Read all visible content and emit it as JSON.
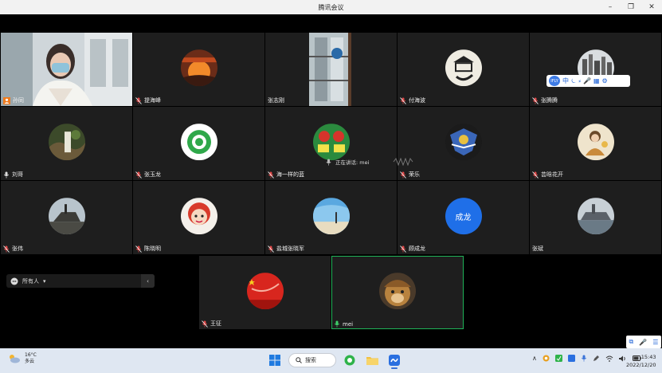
{
  "window": {
    "title": "腾讯会议",
    "minimize": "–",
    "maximize": "❐",
    "close": "✕"
  },
  "participants": [
    {
      "name": "孙同",
      "muted": false,
      "host": true
    },
    {
      "name": "提海峰",
      "muted": true
    },
    {
      "name": "张志刚",
      "muted": true
    },
    {
      "name": "付海波",
      "muted": true
    },
    {
      "name": "张腾腾",
      "muted": true
    },
    {
      "name": "刘哥",
      "muted": false
    },
    {
      "name": "张玉龙",
      "muted": true
    },
    {
      "name": "海一样的蓝",
      "muted": true
    },
    {
      "name": "荣乐",
      "muted": true
    },
    {
      "name": "芸晗花开",
      "muted": true
    },
    {
      "name": "张伟",
      "muted": true
    },
    {
      "name": "陈晓明",
      "muted": true
    },
    {
      "name": "盐城张晓军",
      "muted": true
    },
    {
      "name": "顾成龙",
      "muted": true
    },
    {
      "name": "张斌",
      "muted": true
    },
    {
      "name": "王征",
      "muted": true
    },
    {
      "name": "mei",
      "muted": false,
      "speaking": true
    }
  ],
  "avatar_text": {
    "chenglong": "成龙"
  },
  "floating_toolbar": {
    "badge": "IFLY",
    "items": [
      "中",
      "⏾",
      "⸗",
      "🎤",
      "▦",
      "⚙"
    ]
  },
  "speaking_indicator": {
    "label": "正在讲话: mei"
  },
  "audience": {
    "label": "所有人",
    "arrow": "▾",
    "collapse": "‹"
  },
  "corner_panel": {
    "items": [
      "⧉",
      "🎤",
      "☰"
    ]
  },
  "taskbar": {
    "weather_temp": "16°C",
    "weather_desc": "多云",
    "search_label": "搜索",
    "clock_time": "15:43",
    "clock_date": "2022/12/20",
    "tray_arrow": "∧"
  },
  "colors": {
    "active_border": "#1fb358",
    "accent": "#3d7be6"
  }
}
